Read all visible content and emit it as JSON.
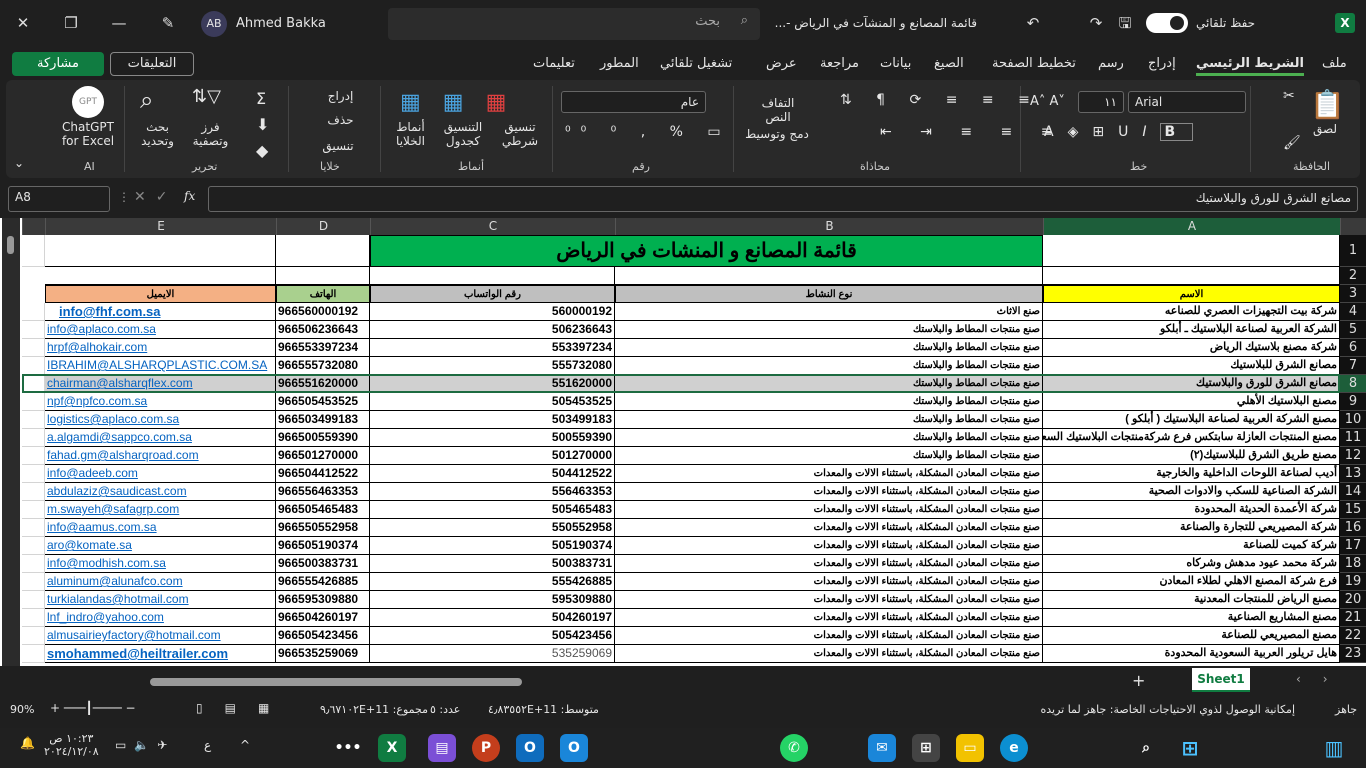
{
  "window": {
    "title": "قائمة المصانع و المنشآت في الرياض -...",
    "user_name": "Ahmed Bakka",
    "user_initials": "AB",
    "search_placeholder": "بحث",
    "autosave_label": "حفظ تلقائي"
  },
  "ribbon_tabs": [
    "ملف",
    "الشريط الرئيسي",
    "إدراج",
    "رسم",
    "تخطيط الصفحة",
    "الصيغ",
    "بيانات",
    "مراجعة",
    "عرض",
    "تشغيل تلقائي",
    "المطور",
    "تعليمات"
  ],
  "ribbon_active": "الشريط الرئيسي",
  "comments_label": "التعليقات",
  "share_label": "مشاركة",
  "ribbon": {
    "clipboard": {
      "label": "الحافظة",
      "paste": "لصق"
    },
    "font": {
      "label": "خط",
      "font_name": "Arial",
      "font_size": "١١"
    },
    "alignment": {
      "label": "محاذاة",
      "wrap": "التفاف النص",
      "merge": "دمج وتوسيط"
    },
    "number": {
      "label": "رقم",
      "format": "عام"
    },
    "styles": {
      "label": "أنماط",
      "conditional": "تنسيق شرطي",
      "table": "التنسيق كجدول",
      "cell_styles": "أنماط الخلايا"
    },
    "cells": {
      "label": "خلايا",
      "insert": "إدراج",
      "delete": "حذف",
      "format": "تنسيق"
    },
    "editing": {
      "label": "تحرير",
      "sort": "فرز وتصفية",
      "find": "بحث وتحديد"
    },
    "ai": {
      "label": "AI",
      "chatgpt": "ChatGPT for Excel",
      "logo": "GPT"
    }
  },
  "formula_bar": {
    "name_box": "A8",
    "formula": "مصانع الشرق للورق والبلاستيك",
    "fx": "fx"
  },
  "columns": [
    "A",
    "B",
    "C",
    "D",
    "E"
  ],
  "sheet_title": "قائمة المصانع و المنشات في الرياض",
  "headers": {
    "name": "الاسم",
    "activity": "نوع النشاط",
    "whatsapp": "رقم الواتساب",
    "phone": "الهاتف",
    "email": "الايميل"
  },
  "header_colors": {
    "name": "#ffff00",
    "activity": "#bfbfbf",
    "whatsapp": "#bfbfbf",
    "phone": "#a9d08e",
    "email": "#f4b084",
    "title": "#00b050"
  },
  "selected_row": 8,
  "rows": [
    {
      "n": 4,
      "name": "شركة بيت التجهيزات العصري للصناعه",
      "activity": "صنع الاثاث",
      "whatsapp": "560000192",
      "phone": "966560000192",
      "email": "info@fhf.com.sa"
    },
    {
      "n": 5,
      "name": "الشركة العربية لصناعة البلاستيك ـ أبلكو",
      "activity": "صنع منتجات المطاط والبلاستك",
      "whatsapp": "506236643",
      "phone": "966506236643",
      "email": "info@aplaco.com.sa"
    },
    {
      "n": 6,
      "name": "شركة مصنع بلاستيك الرياض",
      "activity": "صنع منتجات المطاط والبلاستك",
      "whatsapp": "553397234",
      "phone": "966553397234",
      "email": "hrpf@alhokair.com"
    },
    {
      "n": 7,
      "name": "مصانع الشرق للبلاستيك",
      "activity": "صنع منتجات المطاط والبلاستك",
      "whatsapp": "555732080",
      "phone": "966555732080",
      "email": "IBRAHIM@ALSHARQPLASTIC.COM.SA"
    },
    {
      "n": 8,
      "name": "مصانع الشرق للورق والبلاستيك",
      "activity": "صنع منتجات المطاط والبلاستك",
      "whatsapp": "551620000",
      "phone": "966551620000",
      "email": "chairman@alsharqflex.com"
    },
    {
      "n": 9,
      "name": "مصنع البلاستيك الأهلي",
      "activity": "صنع منتجات المطاط والبلاستك",
      "whatsapp": "505453525",
      "phone": "966505453525",
      "email": "npf@npfco.com.sa"
    },
    {
      "n": 10,
      "name": "مصنع الشركة العربية لصناعة البلاستيك  ( أبلكو )",
      "activity": "صنع منتجات المطاط والبلاستك",
      "whatsapp": "503499183",
      "phone": "966503499183",
      "email": "logistics@aplaco.com.sa"
    },
    {
      "n": 11,
      "name": "مصنع المنتجات العازلة سابتكس فرع شركةمنتجات البلاستيك السعودية",
      "activity": "صنع منتجات المطاط والبلاستك",
      "whatsapp": "500559390",
      "phone": "966500559390",
      "email": "a.algamdi@sappco.com.sa"
    },
    {
      "n": 12,
      "name": "مصنع طريق الشرق للبلاستيك(٢)",
      "activity": "صنع منتجات المطاط والبلاستك",
      "whatsapp": "501270000",
      "phone": "966501270000",
      "email": "fahad.gm@alsharqroad.com"
    },
    {
      "n": 13,
      "name": "أديب لصناعة اللوحات الداخلية والخارجية",
      "activity": "صنع منتجات المعادن المشكلة، باستثناء الالات والمعدات",
      "whatsapp": "504412522",
      "phone": "966504412522",
      "email": "info@adeeb.com"
    },
    {
      "n": 14,
      "name": "الشركة الصناعية للسكب والادوات الصحية",
      "activity": "صنع منتجات المعادن المشكلة، باستثناء الالات والمعدات",
      "whatsapp": "556463353",
      "phone": "966556463353",
      "email": "abdulaziz@saudicast.com"
    },
    {
      "n": 15,
      "name": "شركة الأعمدة الحديثة المحدودة",
      "activity": "صنع منتجات المعادن المشكلة، باستثناء الالات والمعدات",
      "whatsapp": "505465483",
      "phone": "966505465483",
      "email": "m.swayeh@safagrp.com"
    },
    {
      "n": 16,
      "name": "شركة المصيريعي للتجارة والصناعة",
      "activity": "صنع منتجات المعادن المشكلة، باستثناء الالات والمعدات",
      "whatsapp": "550552958",
      "phone": "966550552958",
      "email": "info@aamus.com.sa"
    },
    {
      "n": 17,
      "name": "شركة كميت للصناعة",
      "activity": "صنع منتجات المعادن المشكلة، باستثناء الالات والمعدات",
      "whatsapp": "505190374",
      "phone": "966505190374",
      "email": "aro@komate.sa"
    },
    {
      "n": 18,
      "name": "شركة محمد عيود مدهش وشركاه",
      "activity": "صنع منتجات المعادن المشكلة، باستثناء الالات والمعدات",
      "whatsapp": "500383731",
      "phone": "966500383731",
      "email": "info@modhish.com.sa"
    },
    {
      "n": 19,
      "name": "فرع شركة المصنع الاهلي لطلاء المعادن",
      "activity": "صنع منتجات المعادن المشكلة، باستثناء الالات والمعدات",
      "whatsapp": "555426885",
      "phone": "966555426885",
      "email": "aluminum@alunafco.com"
    },
    {
      "n": 20,
      "name": "مصنع الرياض للمنتجات المعدنية",
      "activity": "صنع منتجات المعادن المشكلة، باستثناء الالات والمعدات",
      "whatsapp": "595309880",
      "phone": "966595309880",
      "email": "turkialandas@hotmail.com"
    },
    {
      "n": 21,
      "name": "مصنع المشاريع الصناعية",
      "activity": "صنع منتجات المعادن المشكلة، باستثناء الالات والمعدات",
      "whatsapp": "504260197",
      "phone": "966504260197",
      "email": "lnf_indro@yahoo.com"
    },
    {
      "n": 22,
      "name": "مصنع المصيريعي للصناعة",
      "activity": "صنع منتجات المعادن المشكلة، باستثناء الالات والمعدات",
      "whatsapp": "505423456",
      "phone": "966505423456",
      "email": "almusairieyfactory@hotmail.com"
    },
    {
      "n": 23,
      "name": "هايل تريلور العربية السعودية المحدودة",
      "activity": "صنع منتجات المعادن المشكلة، باستثناء الالات والمعدات",
      "whatsapp": "535259069",
      "phone": "966535259069",
      "email": "smohammed@heiltrailer.com"
    }
  ],
  "sheet_tab": "Sheet1",
  "status": {
    "ready": "جاهز",
    "accessibility": "إمكانية الوصول لذوي الاحتياجات الخاصة: جاهز لما تريده",
    "average": "متوسط: ٤٫٨٣٥٥٢E+11",
    "count": "عدد: ٥",
    "sum": "مجموع: ٩٫٦٧١٠٢E+11",
    "zoom": "90%"
  },
  "taskbar": {
    "time": "١٠:٢٣ ص",
    "date": "٢٠٢٤/١٢/٠٨",
    "lang": "ع"
  }
}
